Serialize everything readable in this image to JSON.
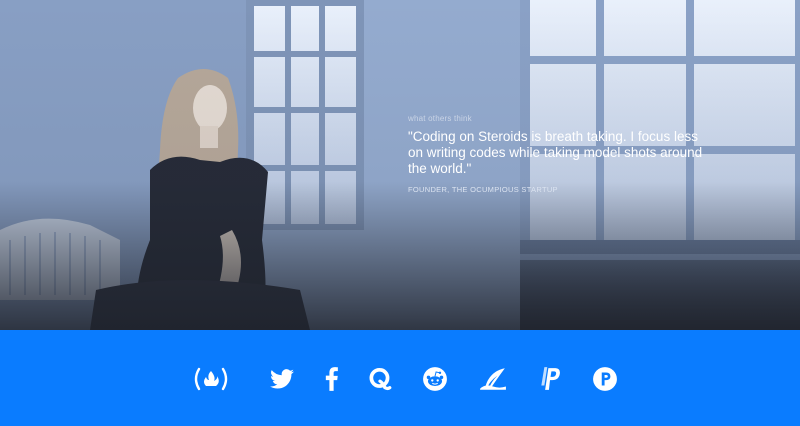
{
  "testimonial": {
    "eyebrow": "what others think",
    "quote": "\"Coding on Steroids is breath taking. I focus less on writing codes while taking model shots around the world.\"",
    "author": "FOUNDER, THE OCUMPIOUS STARTUP"
  },
  "social": {
    "links": [
      {
        "name": "freecodecamp",
        "icon": "freecodecamp-icon"
      },
      {
        "name": "twitter",
        "icon": "twitter-icon"
      },
      {
        "name": "facebook",
        "icon": "facebook-icon"
      },
      {
        "name": "quora",
        "icon": "quora-icon"
      },
      {
        "name": "reddit",
        "icon": "reddit-icon"
      },
      {
        "name": "hashnode",
        "icon": "quill-icon"
      },
      {
        "name": "paypal",
        "icon": "paypal-icon"
      },
      {
        "name": "patreon",
        "icon": "patreon-icon"
      }
    ]
  },
  "colors": {
    "footer_background": "#0a7cff",
    "footer_icon": "#ffffff",
    "hero_tint": "#8ea6cc",
    "hero_shadow": "#1e222b"
  }
}
